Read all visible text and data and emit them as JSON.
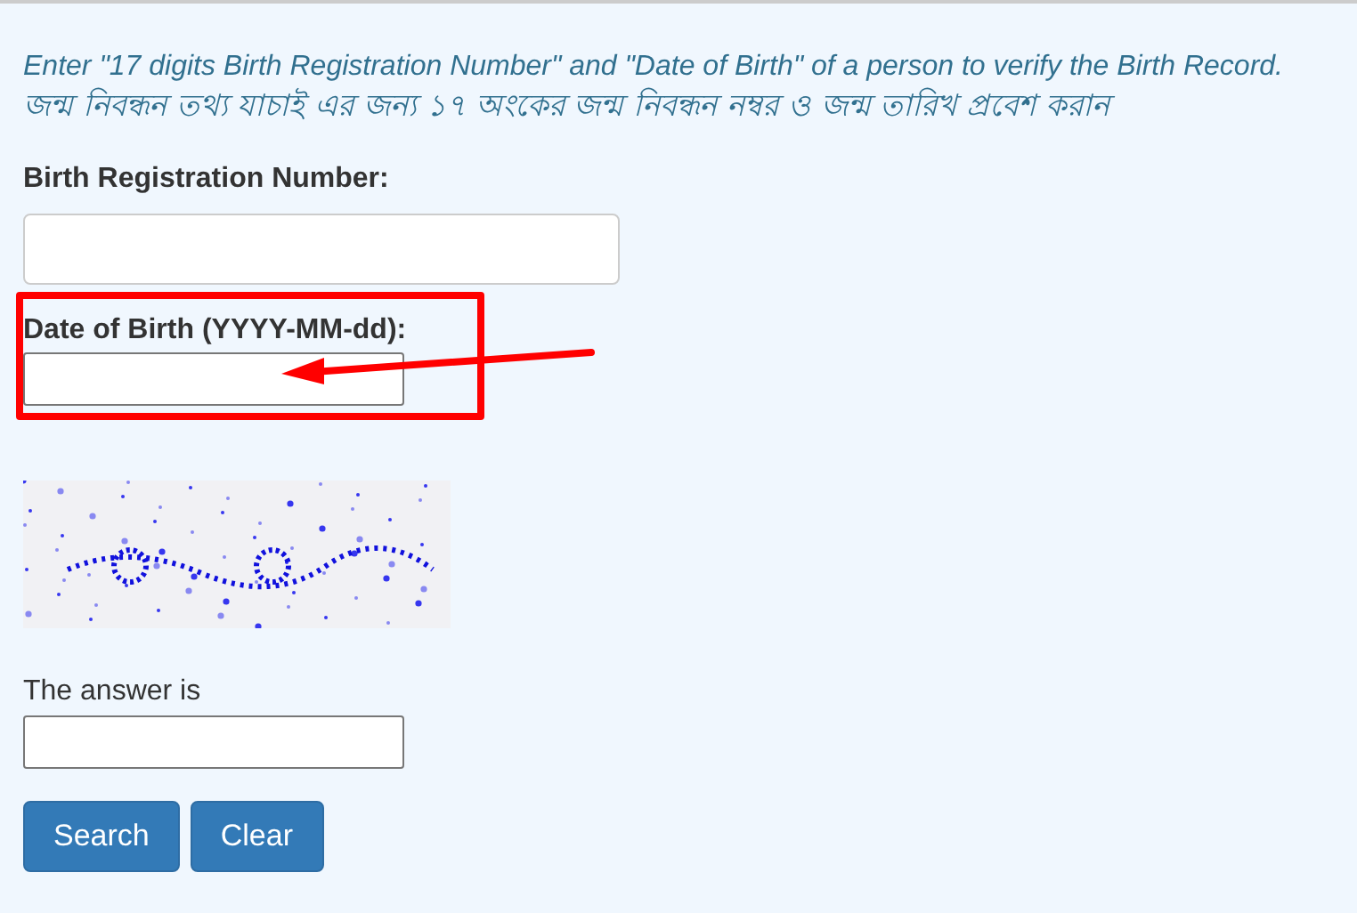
{
  "intro": [
    "Enter \"17 digits Birth Registration Number\" and \"Date of Birth\" of a person to verify the Birth Record.",
    "জন্ম নিবন্ধন তথ্য যাচাই এর জন্য ১৭ অংকের জন্ম নিবন্ধন নম্বর ও জন্ম তারিখ প্রবেশ করান"
  ],
  "fields": [
    {
      "label": "Birth Registration Number:",
      "kind": "wide"
    },
    {
      "label": "Date of Birth (YYYY-MM-dd):",
      "kind": "highlighted"
    }
  ],
  "answer": {
    "label": "The answer is"
  },
  "buttons": [
    "Search",
    "Clear"
  ]
}
